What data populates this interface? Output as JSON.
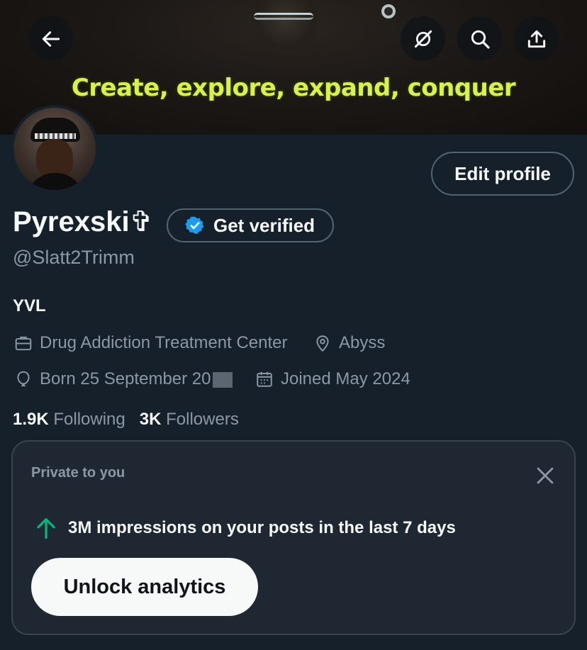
{
  "banner": {
    "text": "Create, explore, expand, conquer"
  },
  "header": {
    "back_icon": "arrow-left-icon",
    "grok_icon": "grok-icon",
    "search_icon": "search-icon",
    "share_icon": "share-icon"
  },
  "profile": {
    "name": "Pyrexski✞",
    "handle": "@Slatt2Trimm",
    "bio": "YVL",
    "edit_label": "Edit profile",
    "get_verified_label": "Get verified",
    "category": "Drug Addiction Treatment Center",
    "location": "Abyss",
    "birthday": "Born 25 September 20",
    "joined": "Joined May 2024",
    "following_count": "1.9K",
    "following_label": "Following",
    "followers_count": "3K",
    "followers_label": "Followers"
  },
  "analytics_card": {
    "label": "Private to you",
    "impressions_text": "3M impressions on your posts in the last 7 days",
    "button_label": "Unlock analytics"
  },
  "colors": {
    "background": "#15202b",
    "accent_verified": "#1d9bf0",
    "accent_up": "#00ba7c",
    "banner_text": "#d8f24a"
  }
}
